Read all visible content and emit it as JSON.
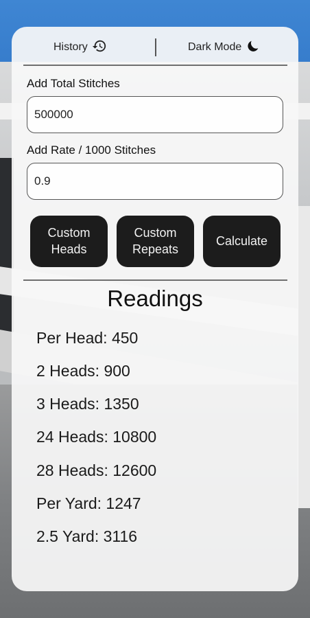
{
  "topbar": {
    "history_label": "History",
    "history_icon": "history-icon",
    "dark_mode_label": "Dark Mode",
    "dark_mode_icon": "moon-icon"
  },
  "form": {
    "total_stitches_label": "Add Total Stitches",
    "total_stitches_value": "500000",
    "rate_label": "Add Rate / 1000 Stitches",
    "rate_value": "0.9"
  },
  "buttons": {
    "custom_heads": "Custom\nHeads",
    "custom_repeats": "Custom\nRepeats",
    "calculate": "Calculate"
  },
  "readings": {
    "title": "Readings",
    "items": [
      "Per Head: 450",
      "2 Heads: 900",
      "3 Heads: 1350",
      "24 Heads: 10800",
      "28 Heads: 12600",
      "Per Yard: 1247",
      "2.5 Yard: 3116"
    ]
  },
  "colors": {
    "button_bg": "#1c1c1c",
    "card_bg": "#f8f8f8",
    "background_blue": "#2f74c5"
  }
}
